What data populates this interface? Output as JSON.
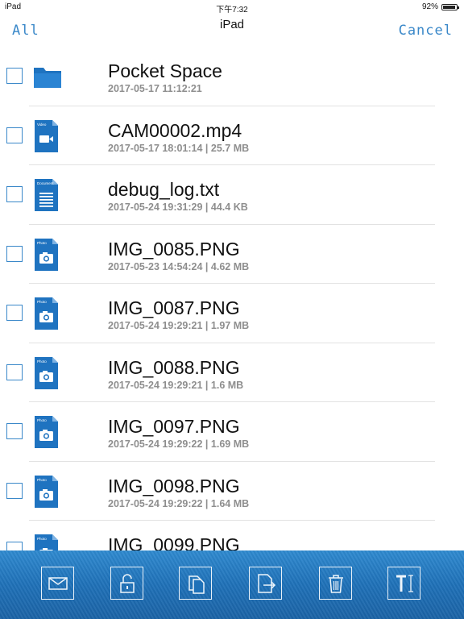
{
  "status_bar": {
    "device": "iPad",
    "time": "下午7:32",
    "battery": "92%",
    "battery_level": 0.92
  },
  "nav": {
    "left_label": "All",
    "title": "iPad",
    "right_label": "Cancel"
  },
  "files": [
    {
      "type": "folder",
      "name": "Pocket Space",
      "meta": "2017-05-17 11:12:21"
    },
    {
      "type": "video",
      "name": "CAM00002.mp4",
      "meta": "2017-05-17 18:01:14 | 25.7 MB"
    },
    {
      "type": "text",
      "name": "debug_log.txt",
      "meta": "2017-05-24 19:31:29 | 44.4 KB"
    },
    {
      "type": "photo",
      "name": "IMG_0085.PNG",
      "meta": "2017-05-23 14:54:24 | 4.62 MB"
    },
    {
      "type": "photo",
      "name": "IMG_0087.PNG",
      "meta": "2017-05-24 19:29:21 | 1.97 MB"
    },
    {
      "type": "photo",
      "name": "IMG_0088.PNG",
      "meta": "2017-05-24 19:29:21 | 1.6 MB"
    },
    {
      "type": "photo",
      "name": "IMG_0097.PNG",
      "meta": "2017-05-24 19:29:22 | 1.69 MB"
    },
    {
      "type": "photo",
      "name": "IMG_0098.PNG",
      "meta": "2017-05-24 19:29:22 | 1.64 MB"
    },
    {
      "type": "photo",
      "name": "IMG_0099.PNG",
      "meta": ""
    }
  ],
  "toolbar": {
    "buttons": [
      {
        "name": "mail-button",
        "icon": "envelope-icon"
      },
      {
        "name": "unlock-button",
        "icon": "unlock-icon"
      },
      {
        "name": "copy-button",
        "icon": "copy-icon"
      },
      {
        "name": "move-button",
        "icon": "move-icon"
      },
      {
        "name": "delete-button",
        "icon": "trash-icon"
      },
      {
        "name": "rename-button",
        "icon": "rename-icon"
      }
    ]
  },
  "colors": {
    "accent": "#3a88c9",
    "icon_blue": "#1f73c0",
    "toolbar": "#1f71b8"
  }
}
